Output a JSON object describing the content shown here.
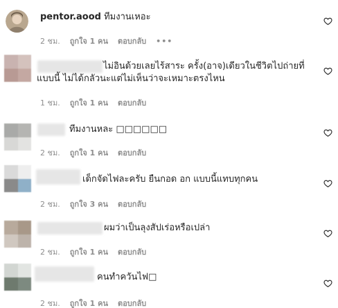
{
  "comments": [
    {
      "username": "pentor.aood",
      "text": "ทีมงานเหอะ",
      "time": "2 ชม.",
      "likes": "ถูกใจ 1 คน",
      "reply": "ตอบกลับ",
      "more": "•••",
      "avatar_colors": [
        "#c8b7a0",
        "#9a8a78",
        "#d8cbb8",
        "#7a6a5a"
      ]
    },
    {
      "username": "",
      "text_line1": "ไม่อินด้วยเลยไร้สาระ ครั้ง(อาจ)เดียวในชีวิตไปถ่ายที่",
      "text_line2": "แบบนี้ ไม่ได้กลัวนะแต่ไม่เห็นว่าจะเหมาะตรงไหน",
      "time": "1 ชม.",
      "likes": "ถูกใจ 1 คน",
      "reply": "ตอบกลับ",
      "avatar_colors": [
        "#c9b3b0",
        "#d4c2bd",
        "#b89a94",
        "#c4a8a2"
      ]
    },
    {
      "username": "",
      "text": "ทีมงานหละ ",
      "emoji_boxes": "□□□□□□",
      "time": "2 ชม.",
      "likes": "ถูกใจ 1 คน",
      "reply": "ตอบกลับ",
      "avatar_colors": [
        "#a9aaa8",
        "#b5b5b2",
        "#d8d8d6",
        "#e3e3e1"
      ]
    },
    {
      "username": "",
      "text": "เด็กจัดไฟละครับ ยืนกอด อก แบบนี้แทบทุกคน",
      "time": "2 ชม.",
      "likes": "ถูกใจ 3 คน",
      "reply": "ตอบกลับ",
      "avatar_colors": [
        "#dadada",
        "#eeeeee",
        "#8a8a8a",
        "#8fb0c8"
      ]
    },
    {
      "username": "",
      "text": "ผมว่าเป็นลุงสัปเร่อหรือเปล่า",
      "time": "2 ชม.",
      "likes": "ถูกใจ 1 คน",
      "reply": "ตอบกลับ",
      "avatar_colors": [
        "#b8aa9c",
        "#a89888",
        "#d0c8c0",
        "#bdb3aa"
      ]
    },
    {
      "username": "",
      "text": "คนทำควันไฟ",
      "emoji_boxes": "□",
      "time": "2 ชม.",
      "likes": "ถูกใจ 1 คน",
      "reply": "ตอบกลับ",
      "avatar_colors": [
        "#d2d6d2",
        "#e2e5e2",
        "#6e7a6e",
        "#7d8a80"
      ]
    }
  ],
  "icons": {
    "like": "heart-outline-icon",
    "more": "more-horizontal-icon"
  }
}
